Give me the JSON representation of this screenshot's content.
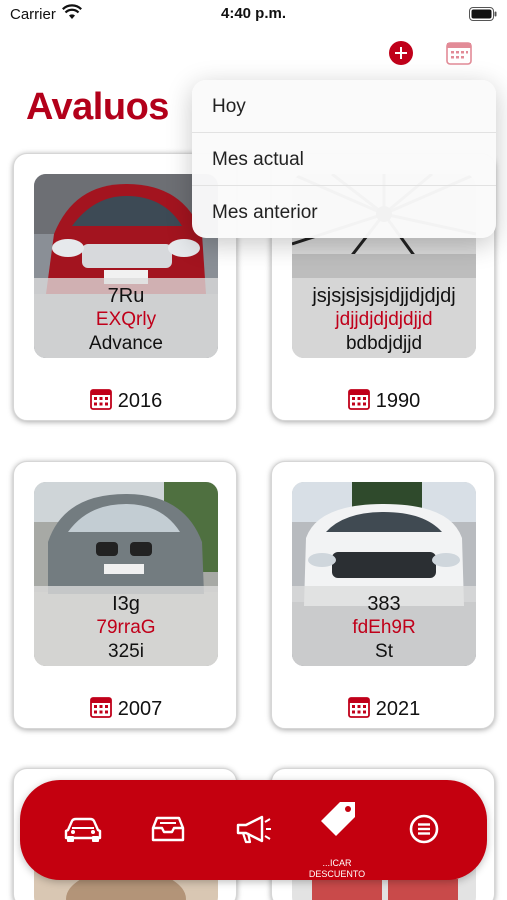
{
  "status_bar": {
    "carrier": "Carrier",
    "time": "4:40 p.m."
  },
  "title": "Avaluos",
  "dropdown": {
    "items": [
      {
        "label": "Hoy"
      },
      {
        "label": "Mes actual"
      },
      {
        "label": "Mes anterior"
      }
    ]
  },
  "cards": [
    {
      "code": "7Ru",
      "plate": "EXQrly",
      "version": "Advance",
      "year": "2016",
      "photo": "red-sedan"
    },
    {
      "code": "jsjsjsjsjsjdjjdjdjdj",
      "plate": "jdjjdjdjdjdjjd",
      "version": "bdbdjdjjd",
      "year": "1990",
      "photo": "umbrella-ceiling"
    },
    {
      "code": "I3g",
      "plate": "79rraG",
      "version": "325i",
      "year": "2007",
      "photo": "gray-bmw"
    },
    {
      "code": "383",
      "plate": "fdEh9R",
      "version": "St",
      "year": "2021",
      "photo": "white-suv"
    }
  ],
  "bottom_nav": {
    "items": [
      {
        "icon": "car-icon"
      },
      {
        "icon": "inbox-icon"
      },
      {
        "icon": "megaphone-icon"
      },
      {
        "icon": "tag-icon"
      },
      {
        "icon": "menu-icon"
      }
    ],
    "peek_label": "...ICAR\nDESCUENTO"
  },
  "colors": {
    "accent": "#c0001a",
    "title": "#b3001a",
    "nav_bar": "#c4000f"
  }
}
